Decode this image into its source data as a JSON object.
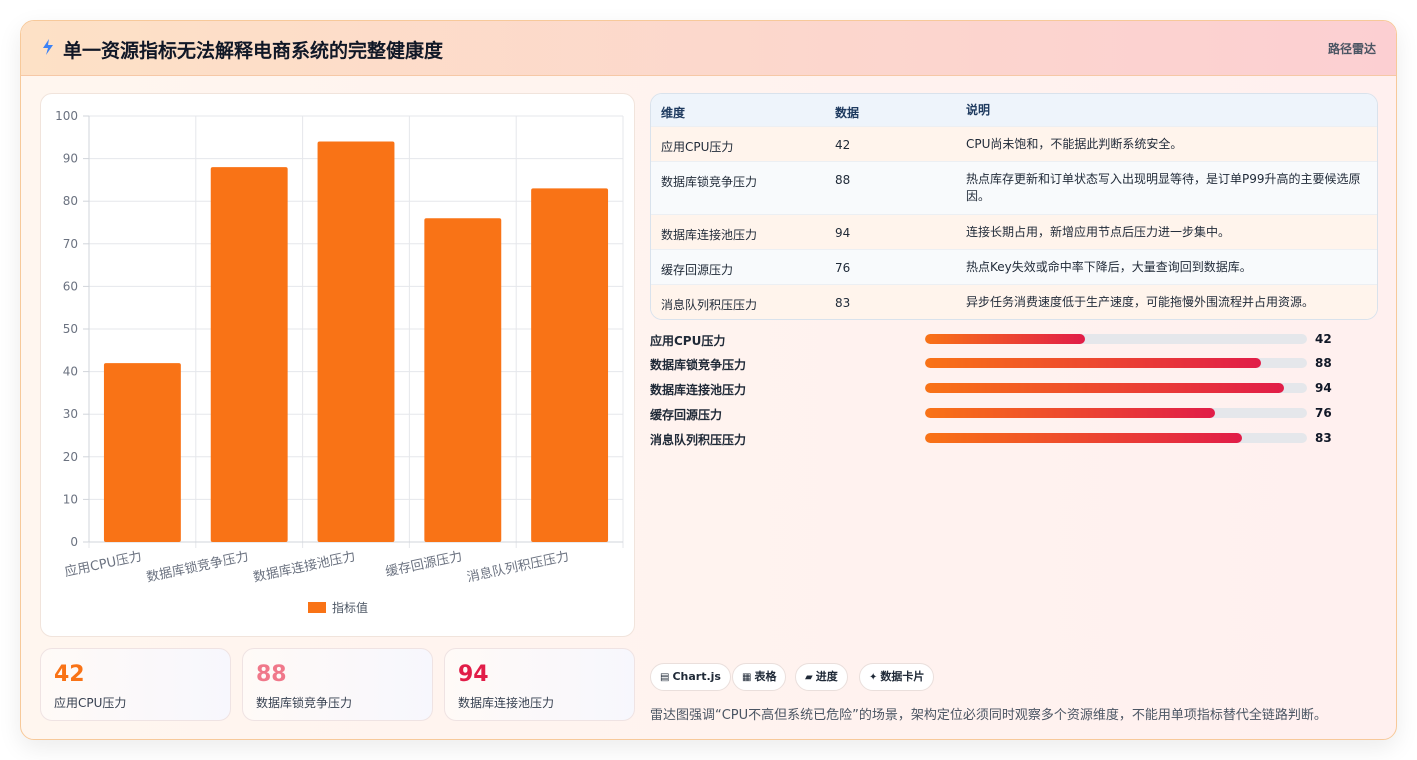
{
  "header": {
    "title": "单一资源指标无法解释电商系统的完整健康度",
    "tag": "路径雷达"
  },
  "chart_data": {
    "type": "bar",
    "categories": [
      "应用CPU压力",
      "数据库锁竞争压力",
      "数据库连接池压力",
      "缓存回源压力",
      "消息队列积压压力"
    ],
    "series": [
      {
        "name": "指标值",
        "values": [
          42,
          88,
          94,
          76,
          83
        ]
      }
    ],
    "ylim": [
      0,
      100
    ],
    "yticks": [
      "0",
      "10",
      "20",
      "30",
      "40",
      "50",
      "60",
      "70",
      "80",
      "90",
      "100"
    ],
    "grid": true,
    "legend": "bottom",
    "color": "#f97316"
  },
  "stats": [
    {
      "value": "42",
      "label": "应用CPU压力",
      "color": "#f97316"
    },
    {
      "value": "88",
      "label": "数据库锁竞争压力",
      "color": "#f0788a"
    },
    {
      "value": "94",
      "label": "数据库连接池压力",
      "color": "#e11d48"
    }
  ],
  "table": {
    "headers": [
      "维度",
      "数据",
      "说明"
    ],
    "rows": [
      {
        "dim": "应用CPU压力",
        "val": "42",
        "desc": "CPU尚未饱和，不能据此判断系统安全。"
      },
      {
        "dim": "数据库锁竞争压力",
        "val": "88",
        "desc": "热点库存更新和订单状态写入出现明显等待，是订单P99升高的主要候选原因。"
      },
      {
        "dim": "数据库连接池压力",
        "val": "94",
        "desc": "连接长期占用，新增应用节点后压力进一步集中。"
      },
      {
        "dim": "缓存回源压力",
        "val": "76",
        "desc": "热点Key失效或命中率下降后，大量查询回到数据库。"
      },
      {
        "dim": "消息队列积压压力",
        "val": "83",
        "desc": "异步任务消费速度低于生产速度，可能拖慢外围流程并占用资源。"
      }
    ]
  },
  "progress": [
    {
      "label": "应用CPU压力",
      "value": 42
    },
    {
      "label": "数据库锁竞争压力",
      "value": 88
    },
    {
      "label": "数据库连接池压力",
      "value": 94
    },
    {
      "label": "缓存回源压力",
      "value": 76
    },
    {
      "label": "消息队列积压压力",
      "value": 83
    }
  ],
  "chips": [
    {
      "icon": "chart-icon",
      "glyph": "▤",
      "label": "Chart.js"
    },
    {
      "icon": "table-icon",
      "glyph": "▦",
      "label": "表格"
    },
    {
      "icon": "progress-icon",
      "glyph": "▰",
      "label": "进度"
    },
    {
      "icon": "sparkle-icon",
      "glyph": "✦",
      "label": "数据卡片"
    }
  ],
  "note": "雷达图强调“CPU不高但系统已危险”的场景，架构定位必须同时观察多个资源维度，不能用单项指标替代全链路判断。"
}
